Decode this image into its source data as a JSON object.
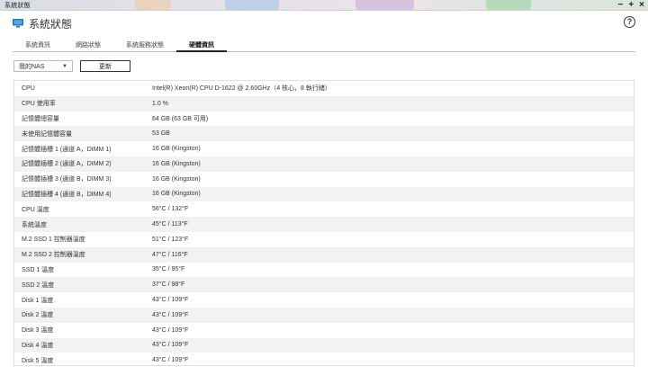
{
  "window": {
    "title": "系統狀態"
  },
  "header": {
    "title": "系統狀態",
    "help": "?"
  },
  "tabs": [
    {
      "label": "系統資訊",
      "active": false
    },
    {
      "label": "網路狀態",
      "active": false
    },
    {
      "label": "系統服務狀態",
      "active": false
    },
    {
      "label": "硬體資訊",
      "active": true
    }
  ],
  "toolbar": {
    "device_select": "我的NAS",
    "refresh_label": "更新"
  },
  "colors": {
    "accent": "#1f6fb5",
    "row_alt": "#f2f2f2"
  },
  "hardware": [
    {
      "label": "CPU",
      "value": "Intel(R) Xeon(R) CPU D-1622 @ 2.60GHz（4 核心，8 執行緒）"
    },
    {
      "label": "CPU 使用率",
      "value": "1.0 %"
    },
    {
      "label": "記憶體總容量",
      "value": "64 GB (63 GB 可用)"
    },
    {
      "label": "未使用記憶體容量",
      "value": "53 GB"
    },
    {
      "label": "記憶體插槽 1 (通道 A，DIMM 1)",
      "value": "16 GB (Kingston)"
    },
    {
      "label": "記憶體插槽 2 (通道 A，DIMM 2)",
      "value": "16 GB (Kingston)"
    },
    {
      "label": "記憶體插槽 3 (通道 B，DIMM 3)",
      "value": "16 GB (Kingston)"
    },
    {
      "label": "記憶體插槽 4 (通道 B，DIMM 4)",
      "value": "16 GB (Kingston)"
    },
    {
      "label": "CPU 溫度",
      "value": "56°C / 132°F"
    },
    {
      "label": "系統溫度",
      "value": "45°C / 113°F"
    },
    {
      "label": "M.2 SSD 1 控制器溫度",
      "value": "51°C / 123°F"
    },
    {
      "label": "M.2 SSD 2 控制器溫度",
      "value": "47°C / 116°F"
    },
    {
      "label": "SSD 1 溫度",
      "value": "35°C / 95°F"
    },
    {
      "label": "SSD 2 溫度",
      "value": "37°C / 98°F"
    },
    {
      "label": "Disk 1 溫度",
      "value": "43°C / 109°F"
    },
    {
      "label": "Disk 2 溫度",
      "value": "43°C / 109°F"
    },
    {
      "label": "Disk 3 溫度",
      "value": "43°C / 109°F"
    },
    {
      "label": "Disk 4 溫度",
      "value": "43°C / 109°F"
    },
    {
      "label": "Disk 5 溫度",
      "value": "43°C / 109°F"
    }
  ]
}
